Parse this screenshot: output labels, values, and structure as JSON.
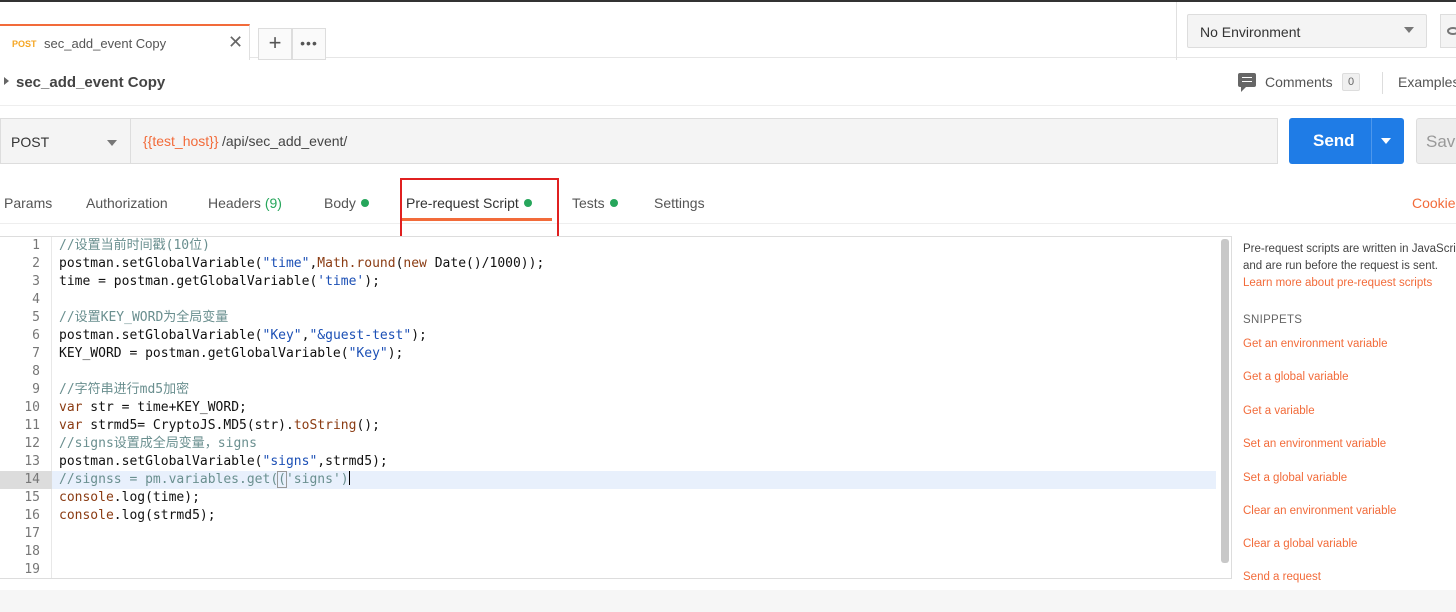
{
  "tab": {
    "method": "POST",
    "title": "sec_add_event Copy",
    "close": "✕",
    "add": "+",
    "more": "•••"
  },
  "environment": {
    "selected": "No Environment"
  },
  "request": {
    "name": "sec_add_event Copy",
    "comments_label": "Comments",
    "comments_count": "0",
    "examples_label": "Examples",
    "method": "POST",
    "url_var": "{{test_host}}",
    "url_path": "/api/sec_add_event/",
    "send_label": "Send",
    "save_label": "Save"
  },
  "subtabs": {
    "params": "Params",
    "authorization": "Authorization",
    "headers": "Headers",
    "headers_count": "(9)",
    "body": "Body",
    "prerequest": "Pre-request Script",
    "tests": "Tests",
    "settings": "Settings",
    "cookies": "Cookies"
  },
  "editor": {
    "line_numbers": [
      "1",
      "2",
      "3",
      "4",
      "5",
      "6",
      "7",
      "8",
      "9",
      "10",
      "11",
      "12",
      "13",
      "14",
      "15",
      "16",
      "17",
      "18",
      "19"
    ],
    "active_line": 14
  },
  "panel": {
    "description": "Pre-request scripts are written in JavaScript, and are run before the request is sent.",
    "learn_more": "Learn more about pre-request scripts",
    "snippets_heading": "SNIPPETS",
    "snippets": [
      "Get an environment variable",
      "Get a global variable",
      "Get a variable",
      "Set an environment variable",
      "Set a global variable",
      "Clear an environment variable",
      "Clear a global variable",
      "Send a request"
    ]
  },
  "colors": {
    "accent": "#f26b3a",
    "send": "#1f7ce6",
    "dot": "#26a65b",
    "highlight": "#e02020"
  }
}
